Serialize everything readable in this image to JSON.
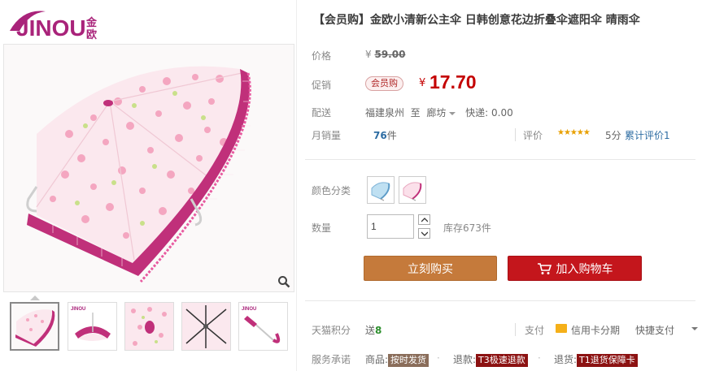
{
  "brand": {
    "logo_text": "JINOU",
    "logo_cn": "金欧",
    "color": "#a9237a"
  },
  "product": {
    "title": "【会员购】金欧小清新公主伞 日韩创意花边折叠伞遮阳伞 晴雨伞"
  },
  "price": {
    "label": "价格",
    "original_currency": "¥",
    "original_value": "59.00",
    "promo_label": "促销",
    "promo_tag": "会员购",
    "promo_currency": "¥",
    "promo_value": "17.70",
    "promo_color": "#c40000"
  },
  "shipping": {
    "label": "配送",
    "from": "福建泉州",
    "to_word": "至",
    "destination": "廊坊",
    "express": "快递: 0.00"
  },
  "sales": {
    "label": "月销量",
    "count": "76",
    "unit": "件",
    "rating_label": "评价",
    "stars": "★★★★★",
    "score": "5分",
    "reviews": "累计评价1"
  },
  "sku": {
    "color_label": "颜色分类",
    "swatches": [
      "blue-umbrella",
      "pink-umbrella"
    ],
    "qty_label": "数量",
    "qty_value": "1",
    "stock": "库存673件"
  },
  "actions": {
    "buy_now": "立刻购买",
    "add_cart": "加入购物车",
    "buy_color": "#c57a3b",
    "cart_color": "#c4161c"
  },
  "points": {
    "label": "天猫积分",
    "give_word": "送",
    "value": "8"
  },
  "payment": {
    "label": "支付",
    "card_install": "信用卡分期",
    "quick_pay": "快捷支付"
  },
  "service": {
    "label": "服务承诺",
    "goods_label": "商品:",
    "goods_tag": "按时发货",
    "refund_label": "退款:",
    "refund_tag": "T3极速退款",
    "return_label": "退货:",
    "return_tag": "T1退货保障卡"
  },
  "icons": {
    "zoom": "magnifier-icon",
    "cart": "cart-icon",
    "card": "credit-card-icon"
  }
}
